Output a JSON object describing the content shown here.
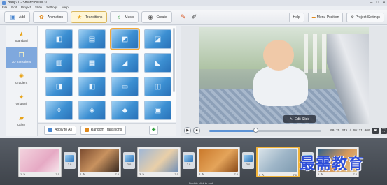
{
  "window": {
    "title": "Baby71 - SmartSHOW 3D",
    "controls": [
      "–",
      "□",
      "✕"
    ]
  },
  "menu": [
    "File",
    "Edit",
    "Project",
    "Slide",
    "Settings",
    "Help"
  ],
  "toolbar": {
    "tabs": [
      {
        "label": "Add",
        "icon": "picture-icon",
        "color": "#4a86cf"
      },
      {
        "label": "Animation",
        "icon": "palette-icon",
        "color": "#e08a1d"
      },
      {
        "label": "Transitions",
        "icon": "star-icon",
        "color": "#e8a41a"
      },
      {
        "label": "Music",
        "icon": "music-note-icon",
        "color": "#2f9e3c"
      },
      {
        "label": "Create",
        "icon": "disc-icon",
        "color": "#555555"
      }
    ],
    "active_tab": "Transitions",
    "tools": [
      "paint-icon",
      "edit-icon"
    ],
    "right_buttons": [
      "Help",
      "Menu Position",
      "Project Settings"
    ]
  },
  "categories": [
    {
      "label": "Standard",
      "icon": "star-icon"
    },
    {
      "label": "3D transitions",
      "icon": "cube-icon"
    },
    {
      "label": "Gradient",
      "icon": "flower-icon"
    },
    {
      "label": "Origami",
      "icon": "fold-icon"
    },
    {
      "label": "Other",
      "icon": "folder-icon"
    }
  ],
  "active_category": "3D transitions",
  "transitions": {
    "tiles": [
      "◧",
      "▤",
      "◩",
      "◪",
      "▥",
      "▦",
      "◢",
      "◣",
      "◨",
      "◧",
      "▭",
      "◫",
      "◊",
      "◈",
      "◆",
      "▣"
    ],
    "selected_index": 2
  },
  "footer": {
    "apply_all": "Apply to All",
    "random": "Random Transitions"
  },
  "preview": {
    "edit_slide": "Edit Slide",
    "timecode": "00:25.375 / 00:31.000",
    "progress": 0.41
  },
  "timeline": {
    "slides": [
      {
        "index": "1",
        "duration": "7.0",
        "thumb": "linear-gradient(135deg,#f3d3de,#e6a9c4 60%,#f7e6ec)"
      },
      {
        "index": "2",
        "duration": "7.0",
        "thumb": "linear-gradient(135deg,#7a4a2e,#c8925f 50%,#3a2a20)"
      },
      {
        "index": "3",
        "duration": "7.0",
        "thumb": "linear-gradient(135deg,#9fb7d6,#e9cfa8 55%,#6f8fb8)"
      },
      {
        "index": "4",
        "duration": "7.0",
        "thumb": "linear-gradient(135deg,#c9782a,#e4a45a 55%,#8a4a18)"
      },
      {
        "index": "5",
        "duration": "7.0",
        "thumb": "linear-gradient(135deg,#d8e2e8,#9fb6c8 50%,#7d9ab0)"
      },
      {
        "index": "6",
        "duration": "7.0",
        "thumb": "linear-gradient(135deg,#2f5f8a,#d89a5a 55%,#e0c48a)"
      }
    ],
    "selected_slide": "5",
    "transitions": [
      "2.0",
      "2.0",
      "2.0",
      "2.0",
      "2.0"
    ],
    "hint": "Double-click to add"
  },
  "watermark": "最需教育"
}
